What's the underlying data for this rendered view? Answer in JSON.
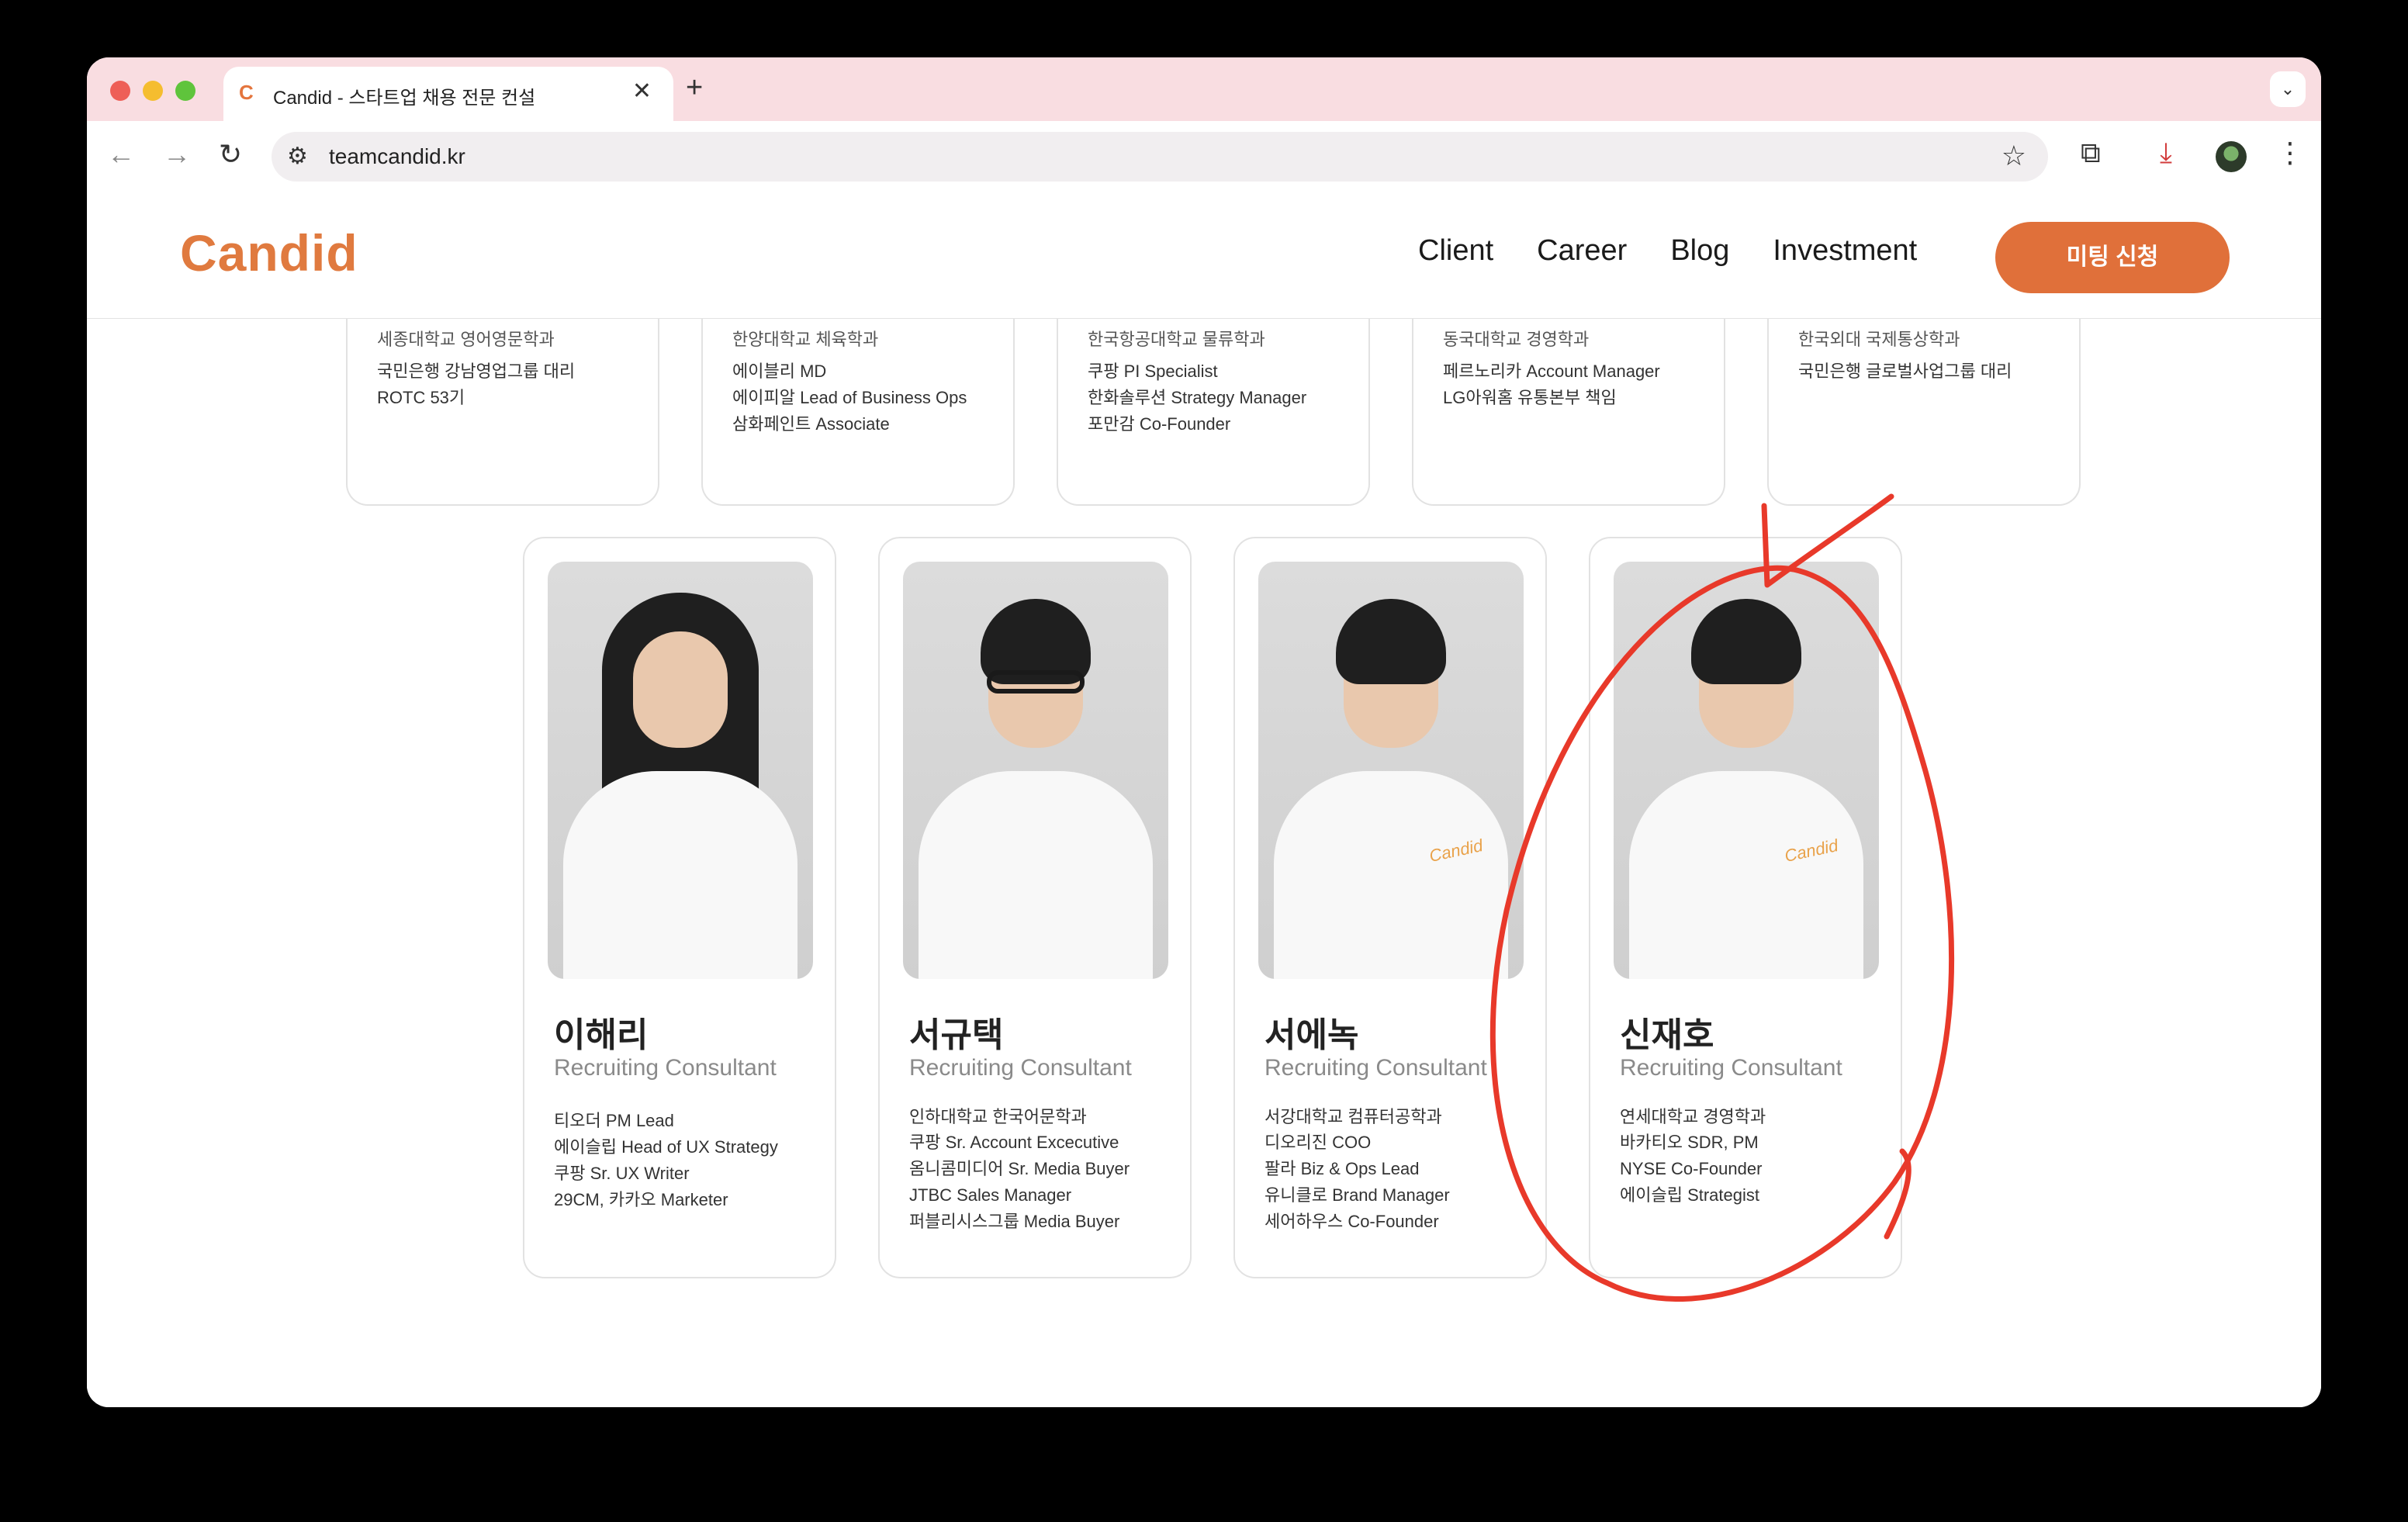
{
  "browser": {
    "tab_favicon": "C",
    "tab_title": "Candid - 스타트업 채용 전문 컨설",
    "tab_close": "✕",
    "new_tab": "+",
    "tab_dropdown": "⌄",
    "url": "teamcandid.kr",
    "icons": [
      "back-arrow-icon",
      "forward-arrow-icon",
      "reload-icon",
      "site-settings-icon",
      "star-icon",
      "extensions-icon",
      "download-icon",
      "profile-avatar",
      "more-menu-icon"
    ]
  },
  "site": {
    "logo": "Candid",
    "nav": [
      "Client",
      "Career",
      "Blog",
      "Investment"
    ],
    "cta": "미팅 신청",
    "accent_color": "#e0703a"
  },
  "top_cards": [
    {
      "edu": "세종대학교 영어영문학과",
      "career": [
        "국민은행 강남영업그룹 대리",
        "ROTC 53기"
      ]
    },
    {
      "edu": "한양대학교 체육학과",
      "career": [
        "에이블리 MD",
        "에이피알 Lead of Business Ops",
        "삼화페인트 Associate"
      ]
    },
    {
      "edu": "한국항공대학교 물류학과",
      "career": [
        "쿠팡 PI Specialist",
        "한화솔루션 Strategy Manager",
        "포만감 Co-Founder"
      ]
    },
    {
      "edu": "동국대학교 경영학과",
      "career": [
        "페르노리카 Account Manager",
        "LG아워홈 유통본부 책임"
      ]
    },
    {
      "edu": "한국외대 국제통상학과",
      "career": [
        "국민은행 글로벌사업그룹 대리"
      ]
    }
  ],
  "members": [
    {
      "name": "이해리",
      "role": "Recruiting Consultant",
      "edu": "",
      "career": [
        "티오더 PM Lead",
        "에이슬립 Head of UX Strategy",
        "쿠팡 Sr. UX Writer",
        "29CM, 카카오 Marketer"
      ]
    },
    {
      "name": "서규택",
      "role": "Recruiting Consultant",
      "edu": "인하대학교 한국어문학과",
      "career": [
        "쿠팡 Sr. Account Excecutive",
        "옴니콤미디어 Sr. Media Buyer",
        "JTBC Sales Manager",
        "퍼블리시스그룹 Media Buyer"
      ]
    },
    {
      "name": "서에녹",
      "role": "Recruiting Consultant",
      "edu": "서강대학교 컴퓨터공학과",
      "career": [
        "디오리진 COO",
        "팔라 Biz & Ops Lead",
        "유니클로 Brand Manager",
        "세어하우스 Co-Founder"
      ]
    },
    {
      "name": "신재호",
      "role": "Recruiting Consultant",
      "edu": "연세대학교 경영학과",
      "career": [
        "바카티오 SDR, PM",
        "NYSE Co-Founder",
        "에이슬립 Strategist"
      ]
    }
  ],
  "shirt_print": "Candid",
  "annotation_color": "#e8392a"
}
